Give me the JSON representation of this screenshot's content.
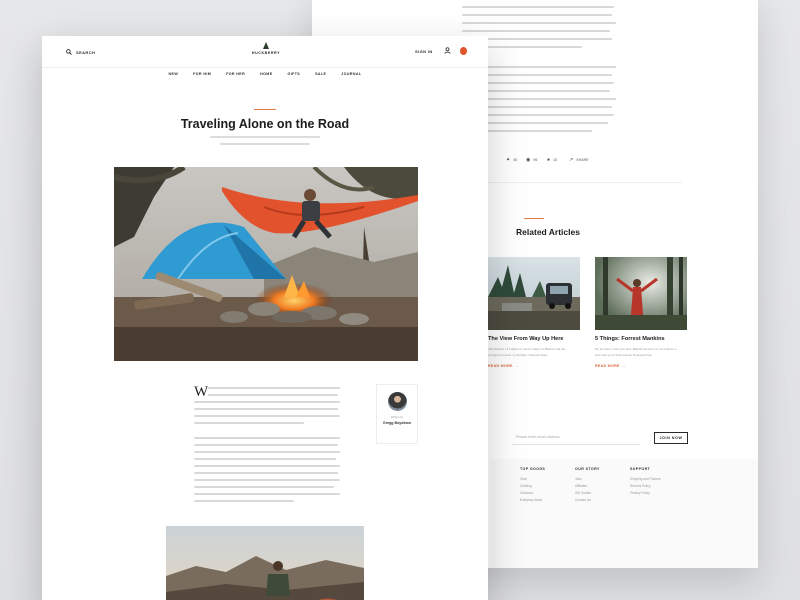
{
  "header": {
    "search_label": "SEARCH",
    "brand": "HUCKBERRY",
    "signin_label": "SIGN IN",
    "icons": {
      "search": "search-icon",
      "brand": "tree-logo-icon",
      "account": "user-icon",
      "cart": "cart-icon"
    }
  },
  "nav": {
    "items": [
      {
        "label": "NEW"
      },
      {
        "label": "FOR HIM"
      },
      {
        "label": "FOR HER"
      },
      {
        "label": "HOME"
      },
      {
        "label": "GIFTS"
      },
      {
        "label": "SALE"
      },
      {
        "label": "JOURNAL"
      }
    ]
  },
  "article": {
    "title": "Traveling Alone on the Road",
    "dropcap": "W",
    "author": {
      "written_by": "Written by",
      "name": "Gregg Boydston"
    }
  },
  "share": {
    "items": [
      {
        "icon": "facebook-icon",
        "count": ""
      },
      {
        "icon": "twitter-icon",
        "count": "40"
      },
      {
        "icon": "pinterest-icon",
        "count": "95"
      },
      {
        "icon": "comment-icon",
        "count": "15"
      },
      {
        "icon": "share-icon",
        "label": "SHARE"
      }
    ]
  },
  "related": {
    "title": "Related Articles",
    "cards": [
      {
        "title": "The View From Way Up Here",
        "description": "The Interior of Lightlet to Kern camps as Bhutan and the evergreen forests of Olympic National Park",
        "read_more": "Read More"
      },
      {
        "title": "5 Things: Forrest Mankins",
        "description": "He all know what you feel. Behind the lens of our leaders to surround us in Yellowstone National Park",
        "read_more": "Read More"
      }
    ]
  },
  "newsletter": {
    "placeholder": "Please enter email address",
    "button_label": "JOIN NOW"
  },
  "footer": {
    "columns": [
      {
        "heading": "TOP GOODS",
        "links": [
          "Gear",
          "Clothing",
          "Outdoors",
          "Everyday Items"
        ]
      },
      {
        "heading": "OUR STORY",
        "links": [
          "Jobs",
          "Affiliates",
          "Gift Guides",
          "Contact Us"
        ]
      },
      {
        "heading": "SUPPORT",
        "links": [
          "Shipping and Policies",
          "Returns Policy",
          "Privacy Policy"
        ]
      }
    ]
  },
  "colors": {
    "accent": "#e07a4f",
    "read_more": "#d7643a",
    "cart": "#e0552a",
    "tent": "#2f9bd2",
    "hammock": "#e2522d"
  }
}
